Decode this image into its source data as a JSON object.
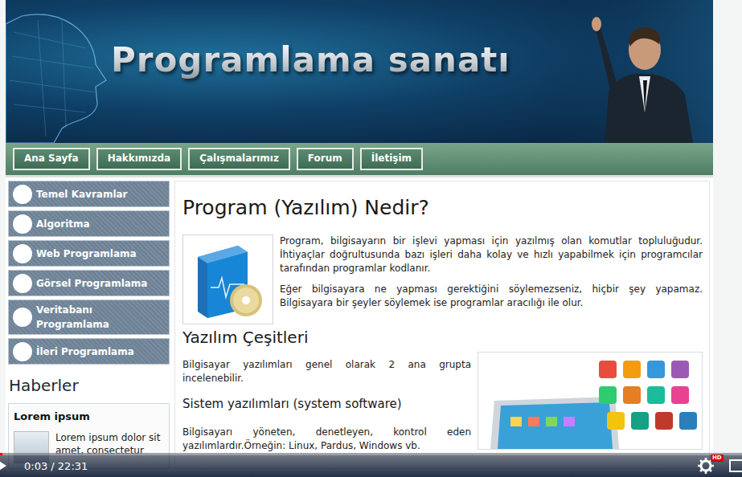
{
  "banner": {
    "title": "Programlama sanatı"
  },
  "nav": [
    {
      "label": "Ana Sayfa"
    },
    {
      "label": "Hakkımızda"
    },
    {
      "label": "Çalışmalarımız"
    },
    {
      "label": "Forum"
    },
    {
      "label": "İletişim"
    }
  ],
  "sidebar": {
    "items": [
      "Temel Kavramlar",
      "Algoritma",
      "Web Programlama",
      "Görsel Programlama",
      "Veritabanı Programlama",
      "İleri Programlama"
    ],
    "news_title": "Haberler",
    "news": [
      {
        "title": "Lorem ipsum",
        "text": "Lorem ipsum dolor sit amet, consectetur"
      }
    ]
  },
  "article": {
    "title": "Program (Yazılım) Nedir?",
    "paragraphs": [
      "Program, bilgisayarın bir işlevi yapması için yazılmış olan komutlar topluluğudur. İhtiyaçlar doğrultusunda bazı işleri daha kolay ve hızlı yapabilmek için programcılar tarafından programlar kodlanır.",
      "Eğer bilgisayara ne yapması gerektiğini söylemezseniz, hiçbir şey yapamaz. Bilgisayara bir şeyler söylemek ise programlar aracılığı ile olur."
    ],
    "section_title": "Yazılım Çeşitleri",
    "section_intro": "Bilgisayar yazılımları genel olarak 2 ana grupta incelenebilir.",
    "subsection_title": "Sistem yazılımları (system software)",
    "subsection_text": "Bilgisayarı yöneten, denetleyen, kontrol eden yazılımlardır.Örneğin: Linux, Pardus, Windows vb."
  },
  "player": {
    "time": "0:03 / 22:31",
    "level": 0.003,
    "quality_badge": "HD"
  }
}
